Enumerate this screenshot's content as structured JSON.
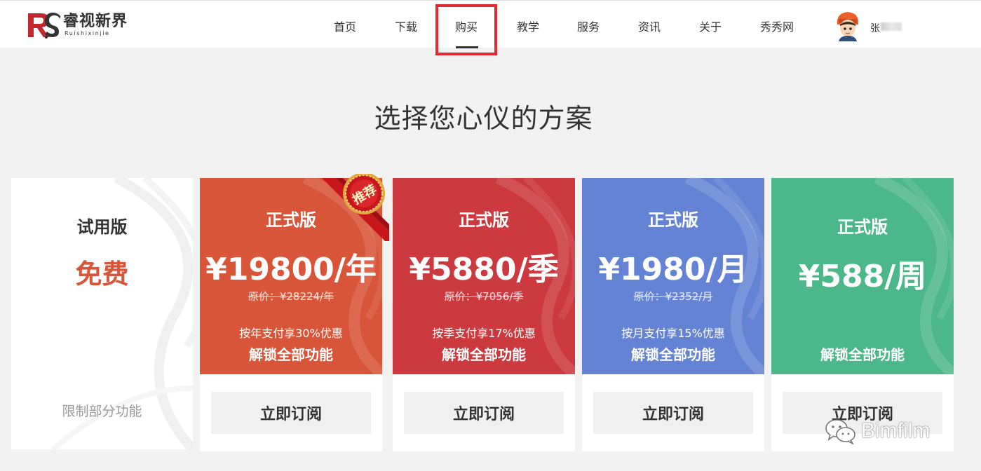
{
  "logo": {
    "cn": "睿视新界",
    "en": "Ruishixinjie",
    "mark": "RS"
  },
  "nav": [
    {
      "label": "首页"
    },
    {
      "label": "下载"
    },
    {
      "label": "购买"
    },
    {
      "label": "教学"
    },
    {
      "label": "服务"
    },
    {
      "label": "资讯"
    },
    {
      "label": "关于"
    },
    {
      "label": "秀秀网"
    }
  ],
  "user": {
    "name": "张"
  },
  "page": {
    "title": "选择您心仪的方案"
  },
  "trial": {
    "name": "试用版",
    "price": "免费",
    "note": "限制部分功能"
  },
  "ribbon": {
    "label": "推荐"
  },
  "plans": [
    {
      "edition": "正式版",
      "price": "¥19800/年",
      "original": "原价：¥28224/年",
      "discount": "按年支付享30%优惠",
      "unlock": "解锁全部功能",
      "button": "立即订阅",
      "color": "#d9553a"
    },
    {
      "edition": "正式版",
      "price": "¥5880/季",
      "original": "原价：¥7056/季",
      "discount": "按季支付享17%优惠",
      "unlock": "解锁全部功能",
      "button": "立即订阅",
      "color": "#cc3a3f"
    },
    {
      "edition": "正式版",
      "price": "¥1980/月",
      "original": "原价：¥2352/月",
      "discount": "按月支付享15%优惠",
      "unlock": "解锁全部功能",
      "button": "立即订阅",
      "color": "#6583d4"
    },
    {
      "edition": "正式版",
      "price": "¥588/周",
      "original": "",
      "discount": "",
      "unlock": "解锁全部功能",
      "button": "立即订阅",
      "color": "#4cb78a"
    }
  ],
  "watermark": {
    "text": "Bimfilm"
  },
  "colors": {
    "accent_red": "#e22a2f",
    "trial_price": "#d9553a",
    "nav_text": "#333333"
  }
}
